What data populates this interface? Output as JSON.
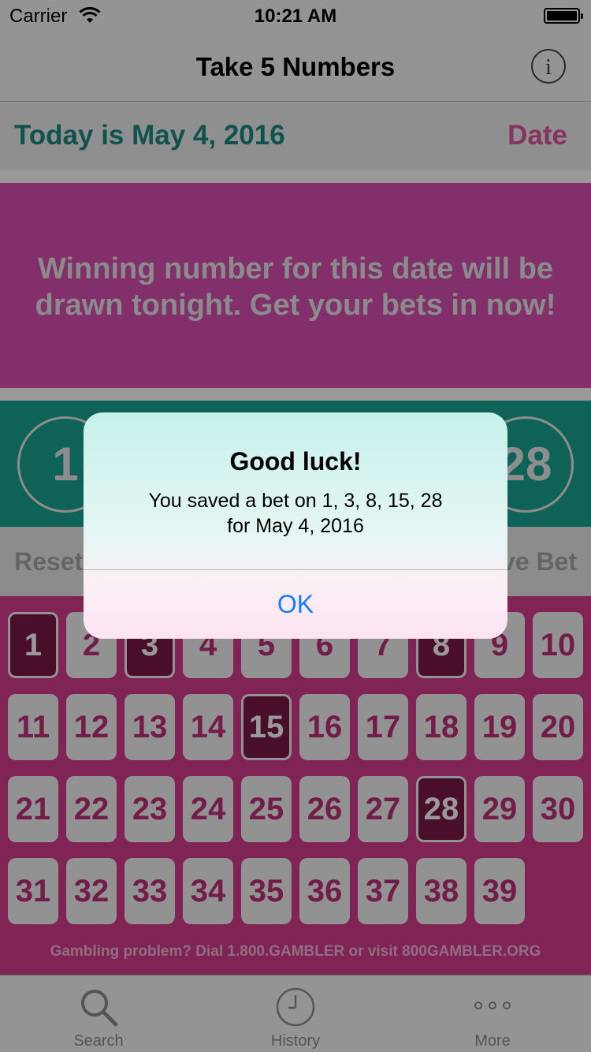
{
  "status_bar": {
    "carrier": "Carrier",
    "time": "10:21 AM"
  },
  "nav": {
    "title": "Take 5 Numbers",
    "info_glyph": "i"
  },
  "date_bar": {
    "today_text": "Today is May 4, 2016",
    "date_button": "Date"
  },
  "banner": {
    "message": "Winning number for this date will be drawn tonight. Get your bets in now!"
  },
  "picks": [
    "1",
    "3",
    "8",
    "15",
    "28"
  ],
  "actions": {
    "reset_label": "Reset",
    "save_label": "Save Bet"
  },
  "grid": {
    "numbers": [
      "1",
      "2",
      "3",
      "4",
      "5",
      "6",
      "7",
      "8",
      "9",
      "10",
      "11",
      "12",
      "13",
      "14",
      "15",
      "16",
      "17",
      "18",
      "19",
      "20",
      "21",
      "22",
      "23",
      "24",
      "25",
      "26",
      "27",
      "28",
      "29",
      "30",
      "31",
      "32",
      "33",
      "34",
      "35",
      "36",
      "37",
      "38",
      "39"
    ],
    "selected": [
      "1",
      "3",
      "8",
      "15",
      "28"
    ]
  },
  "gamble_note": "Gambling problem? Dial 1.800.GAMBLER or visit 800GAMBLER.ORG",
  "tabs": [
    {
      "label": "Search",
      "icon": "search-icon"
    },
    {
      "label": "History",
      "icon": "clock-icon"
    },
    {
      "label": "More",
      "icon": "more-icon"
    }
  ],
  "alert": {
    "title": "Good luck!",
    "message_line1": "You saved a bet on 1, 3, 8, 15, 28",
    "message_line2": "for May 4, 2016",
    "ok_label": "OK"
  },
  "colors": {
    "teal": "#18a392",
    "magenta": "#d63d8f",
    "pink_accent": "#e0559e",
    "selected_tile": "#7a1a47",
    "ios_blue": "#157efb"
  }
}
